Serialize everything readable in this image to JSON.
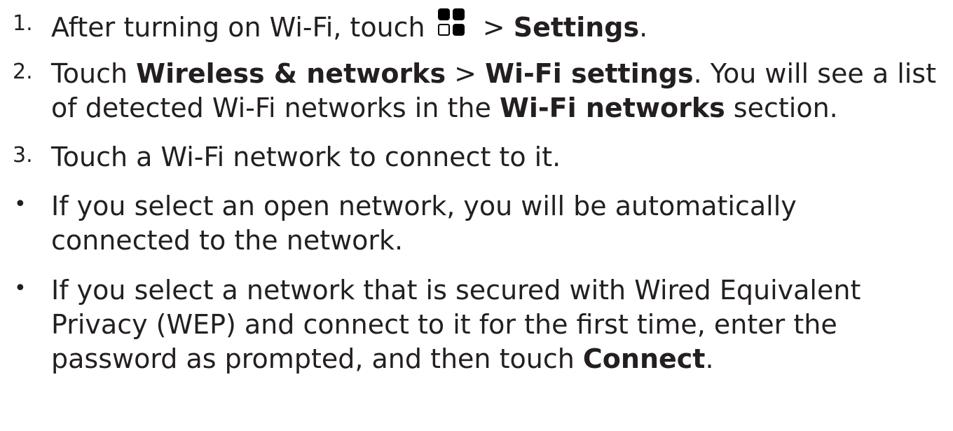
{
  "steps": [
    {
      "number": "1.",
      "before_icon": "After turning on Wi-Fi, touch ",
      "icon": "apps-grid-icon",
      "after_icon": " > ",
      "bold": "Settings",
      "end": "."
    },
    {
      "number": "2.",
      "line1_a": "Touch ",
      "line1_b": "Wireless & networks",
      "line1_c": " > ",
      "line1_d": "Wi-Fi settings",
      "line1_e": ". You will see a list",
      "line2_a": "of detected Wi-Fi networks in the ",
      "line2_b": "Wi-Fi networks",
      "line2_c": " section."
    },
    {
      "number": "3.",
      "text": "Touch a Wi-Fi network to connect to it."
    }
  ],
  "bullets": [
    {
      "symbol": "•",
      "line1": "If you select an open network, you will be automatically",
      "line2": "connected to the network."
    },
    {
      "symbol": "•",
      "line1": "If you select a network that is secured with Wired Equivalent",
      "line2": "Privacy (WEP) and connect to it for the first time, enter the",
      "line3_a": "password as prompted, and then touch ",
      "line3_b": "Connect",
      "line3_c": "."
    }
  ]
}
